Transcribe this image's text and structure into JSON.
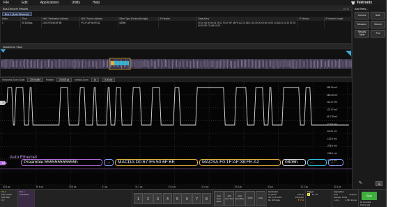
{
  "menu": [
    "File",
    "Edit",
    "Applications",
    "Utility",
    "Help"
  ],
  "brand": "Tektronix",
  "side_panel": {
    "add_new": "Add New...",
    "buttons": [
      "Cursors",
      "Note",
      "Measure",
      "Search",
      "Results Table",
      "Plot"
    ]
  },
  "results": {
    "title": "Bus Decode Results",
    "bus_tab": "Bus 1 (Auto Ethernet)",
    "columns": [
      "Index",
      "Time",
      "MAC Destination Address",
      "MAC Source Address",
      "Ether Type (Protocol/Length)",
      "IP Header",
      "Data (Hex)",
      "IP Version",
      "IP Header Length"
    ],
    "row": {
      "index": "1",
      "time": "30.6024µs",
      "mac_dest": "D0:67:E5:50:6F:6E",
      "mac_src": "F0:1F:AF:38:FE:A2",
      "ether_type": "0806h",
      "data": "00 01 08 00 06 04 00 01 F0 1F AF 38 FE A2 C0 A8 01 01 00 00 00 00 00 00 C0 A8 01 01 20 67 E5 50 6F 6E C0 A8 01 05 ...",
      "ip_version": "",
      "ip_hdr_len": ""
    }
  },
  "waveform_view": {
    "title": "Waveform View"
  },
  "zoom_bar": {
    "label": "Horizontal Zoom Scale",
    "scale": "200 ns/div",
    "position_label": "Position",
    "position": "25.600 µs",
    "vertical_label": "Vertical Zoom",
    "vertical": "1x",
    "vert_pos": "0.00 div"
  },
  "plot": {
    "y_labels": [
      "355.96 mV",
      "283.26 mV",
      "210.57 mV",
      "137.87 mV",
      "65.178 mV",
      "-7.512 mV",
      "-80.20 mV",
      "-152.9 mV",
      "-225.6 mV",
      "-298.3 mV",
      "-371.0 mV"
    ],
    "x_labels": [
      "30.4 µs",
      "30.6 µs",
      "30.8 µs",
      "31 µs",
      "31.2 µs",
      "31.4 µs",
      "31.6 µs",
      "31.8 µs",
      "32 µs",
      "32.2 µs",
      "32.4 µs"
    ],
    "ch_marker": "3",
    "bus_marker": "B1",
    "bus_name": "Auto Ethernet",
    "packets": [
      {
        "kind": "pre",
        "text": "Preamble:555555555555h"
      },
      {
        "kind": "dots",
        "text": "..."
      },
      {
        "kind": "mac",
        "text": "MACDA:D0:67:E5:50:6F:6E"
      },
      {
        "kind": "mac",
        "text": "MACSA:F0:1F:AF:38:FE:A2"
      },
      {
        "kind": "type",
        "text": "0806h"
      },
      {
        "kind": "tail",
        "text": "..."
      },
      {
        "kind": "dots",
        "text": "..."
      }
    ]
  },
  "status": {
    "ch1": {
      "title": "Ch 1",
      "l1": "100 mV/div",
      "l2": "625 MHz",
      "l3": "0 V"
    },
    "bus1": {
      "title": "Bus 1",
      "l1": "Auto Ethe..."
    },
    "channels": [
      "1",
      "2",
      "3",
      "4",
      "5",
      "6",
      "7",
      "8"
    ],
    "add_buttons": [
      "Add New Math",
      "Add New Ref",
      "Add New Bus"
    ],
    "extra_buttons": [
      "DVM",
      "AFG"
    ],
    "horizontal": {
      "title": "Horizontal",
      "l1": "10 µs/div",
      "l2": "100 µs",
      "l3": "SR: 6.25 GS/s",
      "l4": "RL: 625 kpts",
      "l5": "160 ps/pt",
      "l6": "▼ 0 %"
    },
    "trigger": {
      "title": "Trigger",
      "l1": "1",
      "l2": "32 mV"
    },
    "acquisition": {
      "title": "Acquisition",
      "l1": "Auto",
      "l2": "Analyze",
      "l3": "Sample: 8 bits",
      "l4": "1 Acq",
      "l5": "1.542 kAcqs"
    },
    "run_label": "Stop",
    "date": "18 Jan 2019",
    "time": "8:26:44 AM"
  },
  "colors": {
    "trace": "#d9d9d9",
    "bus": "#c07ae6",
    "mac": "#e0b23a",
    "accent": "#3fae3f"
  }
}
